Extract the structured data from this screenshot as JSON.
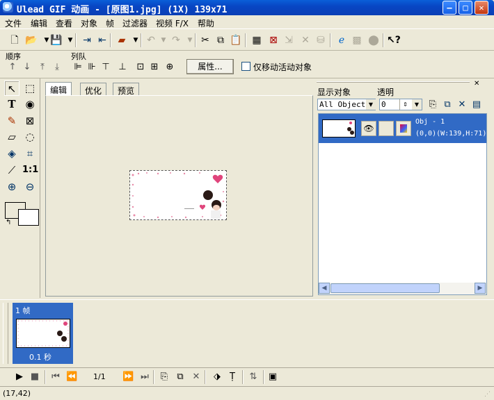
{
  "window": {
    "title": "Ulead GIF 动画 - [原图1.jpg] (1X) 139x71",
    "min": "–",
    "max": "□",
    "close": "✕"
  },
  "menu": [
    "文件",
    "编辑",
    "查看",
    "对象",
    "帧",
    "过滤器",
    "视频 F/X",
    "帮助"
  ],
  "toolbar2": {
    "order_label": "顺序",
    "arrange_label": "列队",
    "properties": "属性...",
    "move_active_only": "仅移动活动对象",
    "move_active_checked": false
  },
  "tabs": [
    "编辑",
    "优化",
    "预览"
  ],
  "active_tab": "编辑",
  "object_panel": {
    "show_label": "显示对象",
    "opacity_label": "透明",
    "show_value": "All Objects",
    "opacity_value": "0",
    "objects": [
      {
        "name": "Obj - 1",
        "geometry": "(0,0)(W:139,H:71)",
        "selected": true
      }
    ]
  },
  "frames": [
    {
      "label": "1 帧",
      "delay": "0.1 秒",
      "selected": true
    }
  ],
  "playback": {
    "counter": "1/1"
  },
  "status": {
    "coords": "(17,42)"
  },
  "colors": {
    "title_bar": "#0a4fd0",
    "selection": "#316ac5",
    "face": "#ece9d8"
  },
  "icons": {
    "toolbar": [
      "new-file-icon",
      "open-folder-icon",
      "save-icon",
      "import-icon",
      "export-icon",
      "color-icon",
      "undo-icon",
      "redo-icon",
      "cut-icon",
      "copy-icon",
      "paste-icon",
      "frame-properties-icon",
      "optimize-icon",
      "tween-icon",
      "delete-icon",
      "share-icon",
      "browser-preview-icon",
      "help-icon"
    ],
    "tools": [
      "pick-tool-icon",
      "crop-tool-icon",
      "text-tool-icon",
      "play-tool-icon",
      "brush-tool-icon",
      "transform-tool-icon",
      "eraser-tool-icon",
      "lasso-tool-icon",
      "fill-tool-icon",
      "marquee-tool-icon",
      "eyedropper-tool-icon",
      "actual-size-icon",
      "zoom-in-icon",
      "zoom-out-icon"
    ]
  }
}
